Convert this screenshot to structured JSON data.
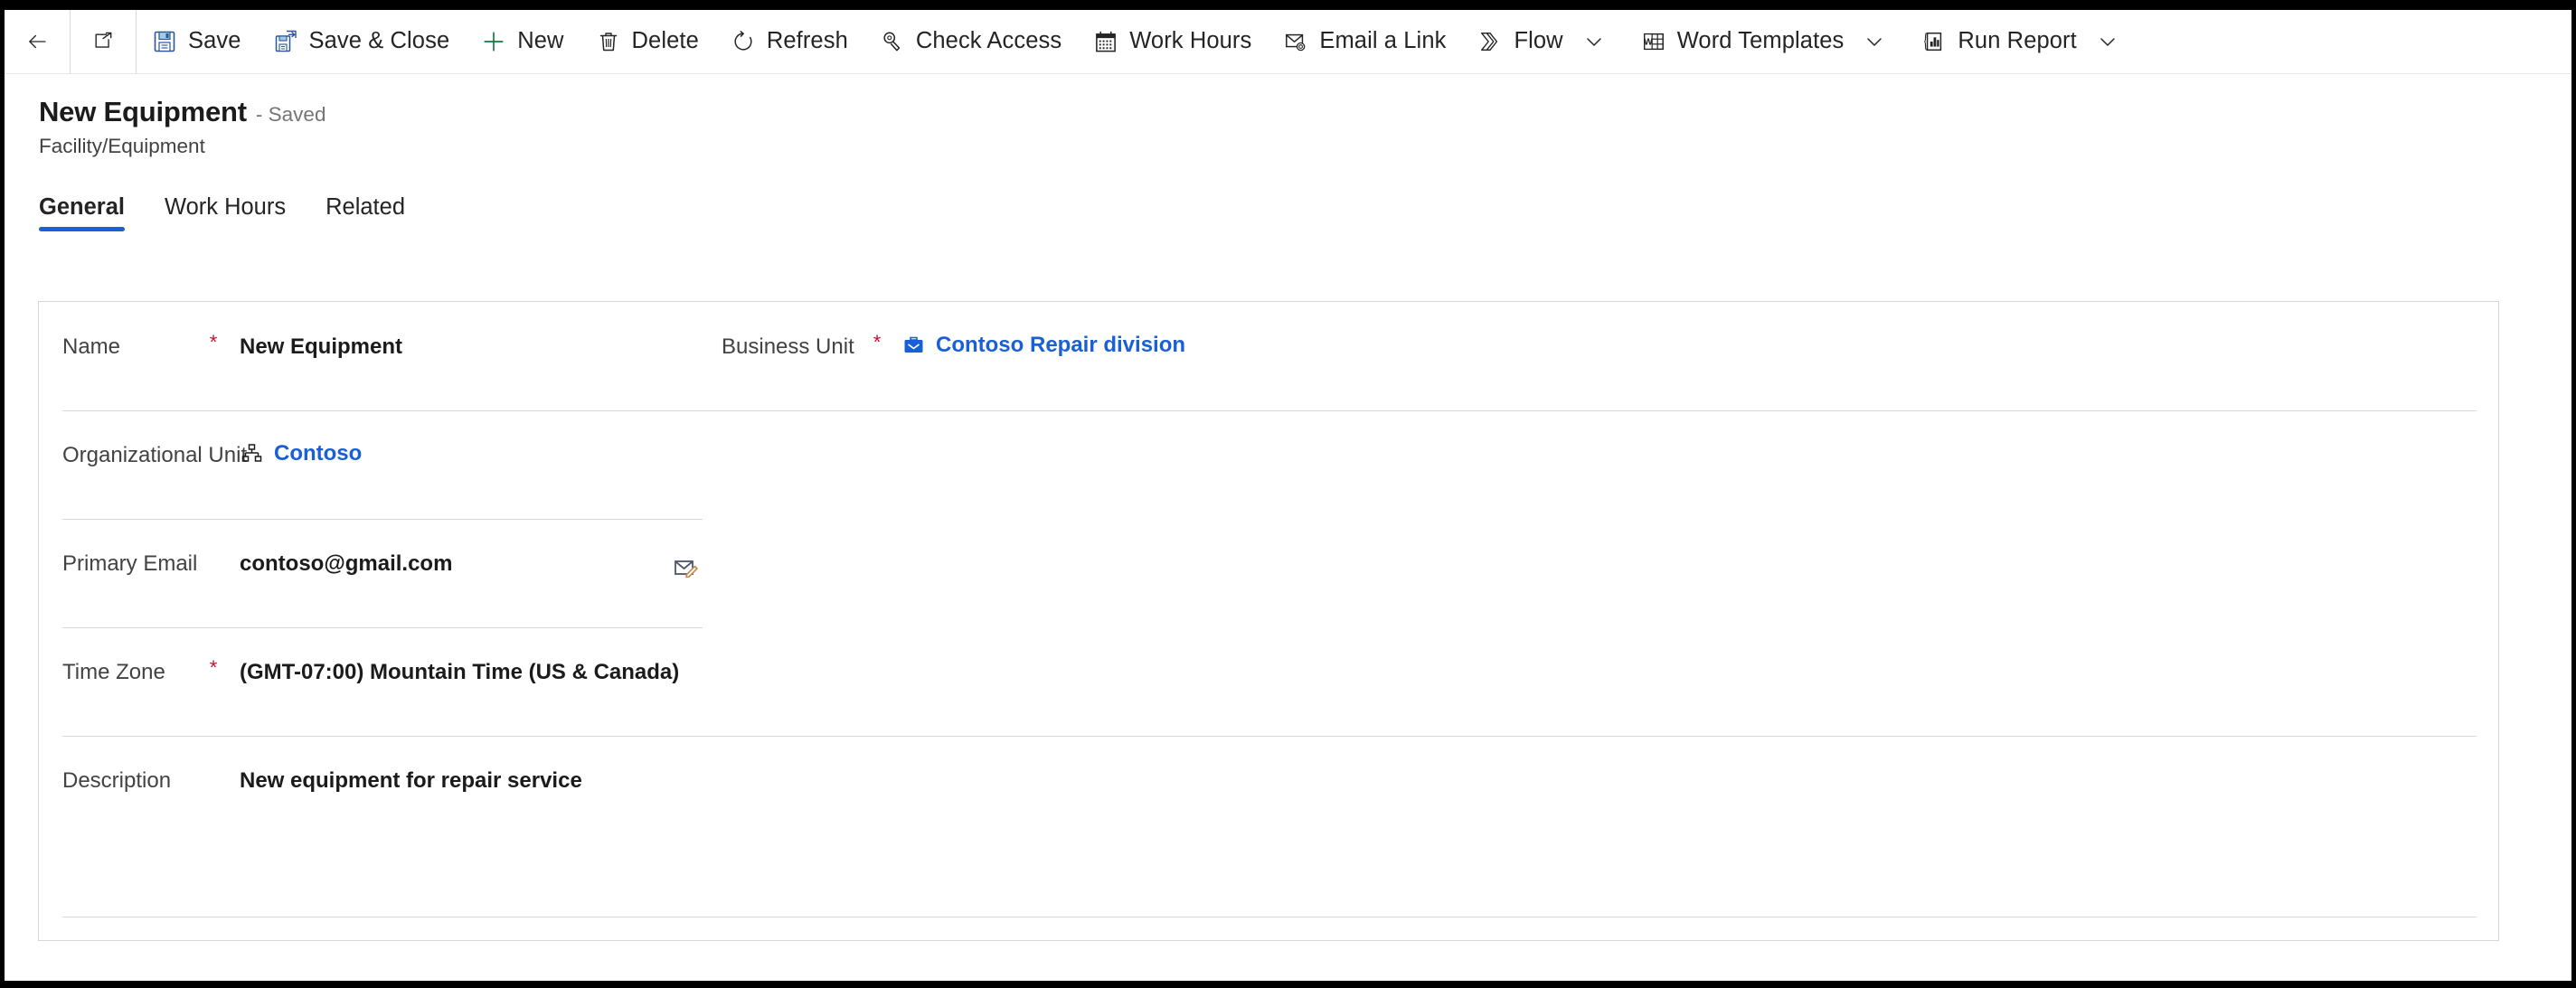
{
  "theme": {
    "accent": "#1a5fd6",
    "required_star": "#c8102e",
    "text_primary": "#1b1b1b",
    "text_secondary": "#424242",
    "muted": "#757575",
    "divider": "#d6d6d6"
  },
  "command_bar": {
    "back_icon": "back-arrow-icon",
    "popout_icon": "open-in-new-window-icon",
    "items": [
      {
        "id": "save",
        "label": "Save",
        "icon": "save-icon",
        "caret": false
      },
      {
        "id": "save-and-close",
        "label": "Save & Close",
        "icon": "save-and-close-icon",
        "caret": false
      },
      {
        "id": "new",
        "label": "New",
        "icon": "plus-icon",
        "caret": false
      },
      {
        "id": "delete",
        "label": "Delete",
        "icon": "trash-icon",
        "caret": false
      },
      {
        "id": "refresh",
        "label": "Refresh",
        "icon": "refresh-icon",
        "caret": false
      },
      {
        "id": "check-access",
        "label": "Check Access",
        "icon": "key-icon",
        "caret": false
      },
      {
        "id": "work-hours",
        "label": "Work Hours",
        "icon": "calendar-icon",
        "caret": false
      },
      {
        "id": "email-a-link",
        "label": "Email a Link",
        "icon": "email-link-icon",
        "caret": false
      },
      {
        "id": "flow",
        "label": "Flow",
        "icon": "flow-icon",
        "caret": true
      },
      {
        "id": "word-templates",
        "label": "Word Templates",
        "icon": "word-doc-icon",
        "caret": true
      },
      {
        "id": "run-report",
        "label": "Run Report",
        "icon": "report-chart-icon",
        "caret": true
      }
    ]
  },
  "header": {
    "title": "New Equipment",
    "state": "- Saved",
    "entity": "Facility/Equipment"
  },
  "tabs": [
    {
      "id": "general",
      "label": "General",
      "active": true
    },
    {
      "id": "work-hours",
      "label": "Work Hours",
      "active": false
    },
    {
      "id": "related",
      "label": "Related",
      "active": false
    }
  ],
  "form": {
    "fields": {
      "name": {
        "label": "Name",
        "required": true,
        "value": "New Equipment"
      },
      "business_unit": {
        "label": "Business Unit",
        "required": true,
        "value": "Contoso Repair division",
        "icon": "business-unit-briefcase-icon",
        "is_link": true
      },
      "organizational_unit": {
        "label": "Organizational Unit",
        "required": false,
        "value": "Contoso",
        "icon": "org-hierarchy-icon",
        "is_link": true
      },
      "primary_email": {
        "label": "Primary Email",
        "required": false,
        "value": "contoso@gmail.com",
        "action_icon": "compose-email-icon"
      },
      "time_zone": {
        "label": "Time Zone",
        "required": true,
        "value": "(GMT-07:00) Mountain Time (US & Canada)"
      },
      "description": {
        "label": "Description",
        "required": false,
        "value": "New equipment for repair service"
      }
    }
  }
}
